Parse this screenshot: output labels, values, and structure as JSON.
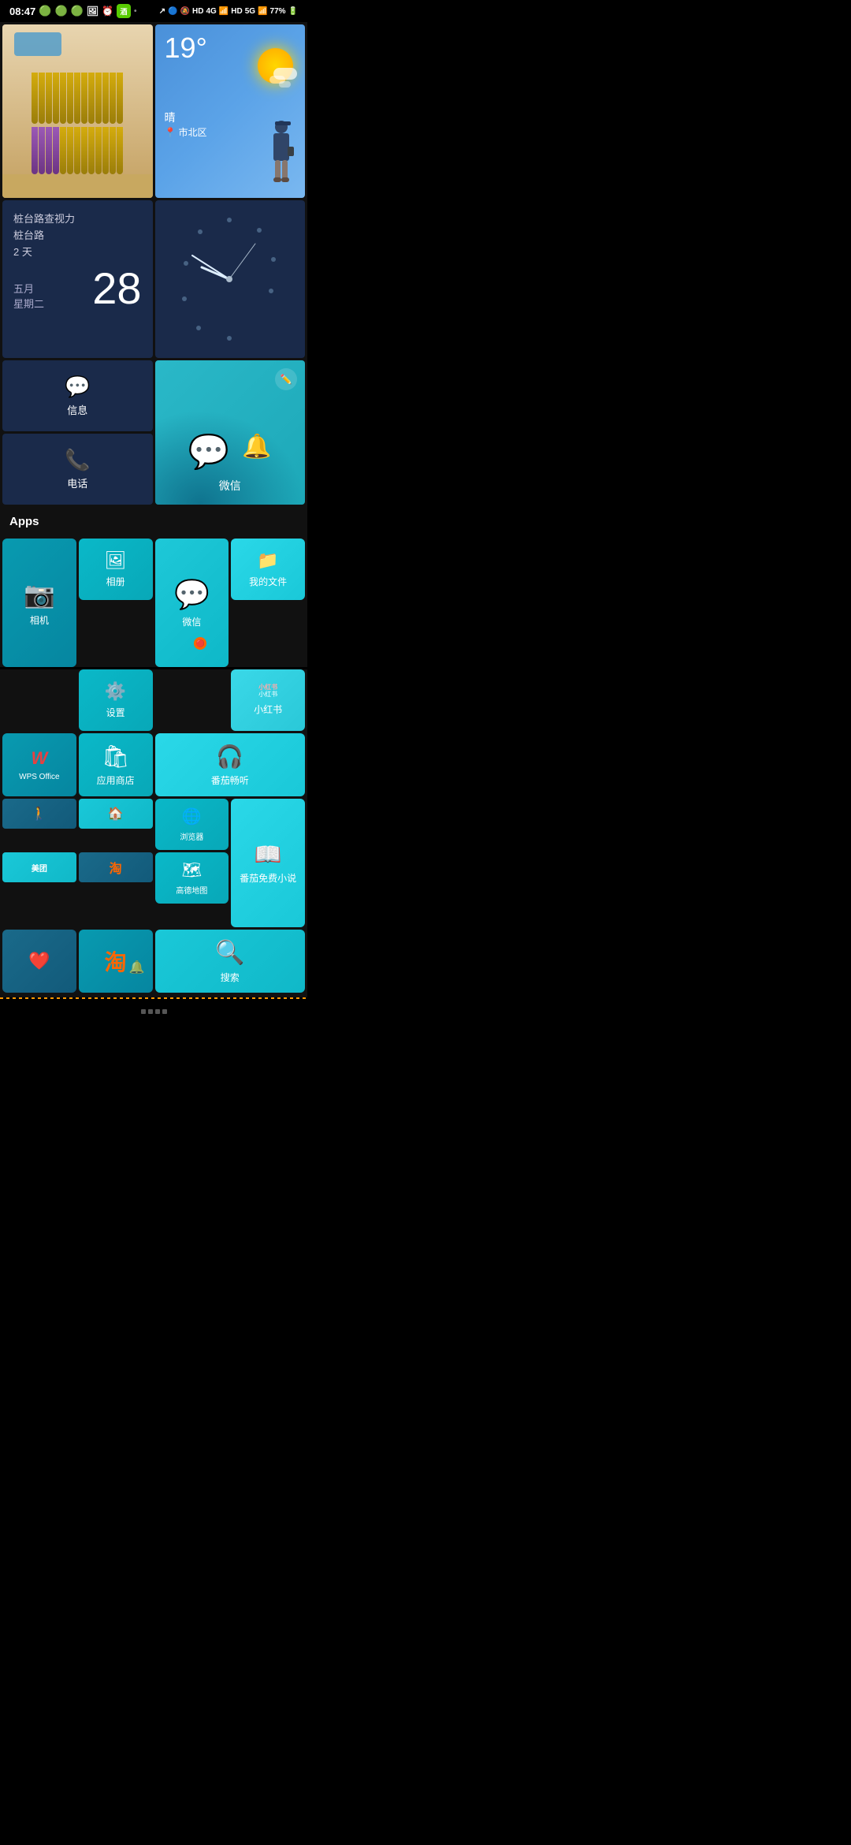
{
  "statusBar": {
    "time": "08:47",
    "batteryPercent": "77%",
    "network1": "HD",
    "network2": "4G",
    "network3": "HD",
    "network4": "5G"
  },
  "weather": {
    "temperature": "19°",
    "condition": "晴",
    "location": "市北区"
  },
  "memo": {
    "title1": "桩台路查视力",
    "title2": "桩台路",
    "title3": "2 天",
    "month": "五月",
    "weekday": "星期二",
    "day": "28"
  },
  "apps": {
    "sectionTitle": "Apps",
    "camera": "相机",
    "album": "相册",
    "settings": "设置",
    "wechat": "微信",
    "myFiles": "我的文件",
    "xiaohongshu": "小红书",
    "wps": "WPS Office",
    "appStore": "应用商店",
    "fangqie": "番茄畅听",
    "browser": "浏览器",
    "amap": "高德地图",
    "fangqieNovel": "番茄免费小说",
    "search": "搜索",
    "messages": "信息",
    "phone": "电话",
    "wechatLarge": "微信",
    "meituan": "美团",
    "taobao": "淘"
  }
}
